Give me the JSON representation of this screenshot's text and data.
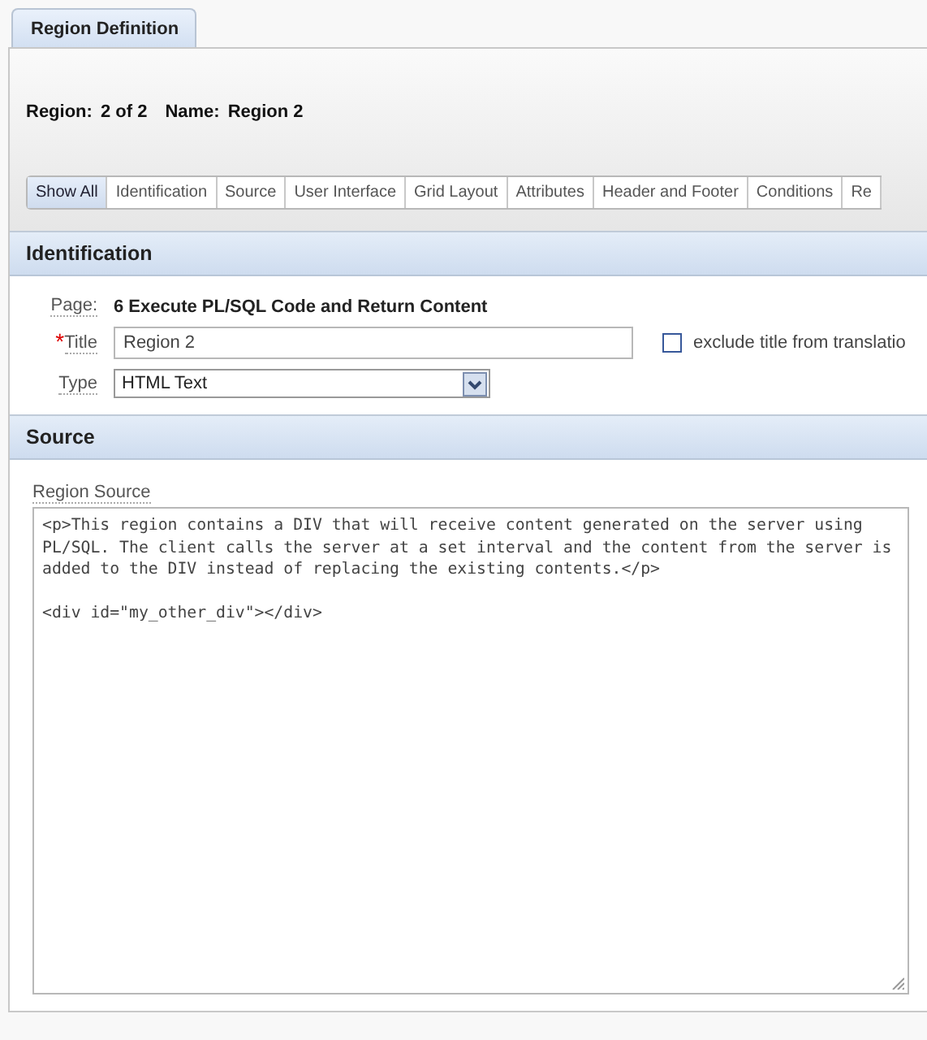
{
  "top_tab": {
    "label": "Region Definition",
    "selected": true
  },
  "region_info": {
    "region_label": "Region:",
    "region_value": "2 of 2",
    "name_label": "Name:",
    "name_value": "Region 2"
  },
  "nav_tabs": [
    {
      "label": "Show All",
      "selected": true
    },
    {
      "label": "Identification",
      "selected": false
    },
    {
      "label": "Source",
      "selected": false
    },
    {
      "label": "User Interface",
      "selected": false
    },
    {
      "label": "Grid Layout",
      "selected": false
    },
    {
      "label": "Attributes",
      "selected": false
    },
    {
      "label": "Header and Footer",
      "selected": false
    },
    {
      "label": "Conditions",
      "selected": false
    },
    {
      "label": "Re",
      "selected": false
    }
  ],
  "identification": {
    "heading": "Identification",
    "page_label": "Page:",
    "page_value": "6 Execute PL/SQL Code and Return Content",
    "title_label": "Title",
    "title_required_mark": "*",
    "title_value": "Region 2",
    "exclude_label": "exclude title from translatio",
    "exclude_checked": false,
    "type_label": "Type",
    "type_value": "HTML Text"
  },
  "source": {
    "heading": "Source",
    "region_source_label": "Region Source",
    "region_source_value": "<p>This region contains a DIV that will receive content generated on the server using PL/SQL. The client calls the server at a set interval and the content from the server is added to the DIV instead of replacing the existing contents.</p>\n\n<div id=\"my_other_div\"></div>"
  }
}
